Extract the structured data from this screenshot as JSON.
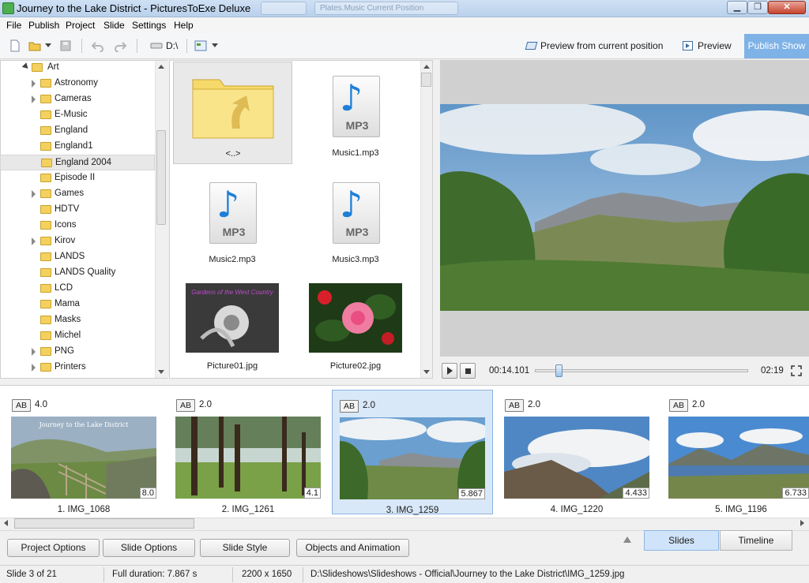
{
  "window": {
    "title": "Journey to the Lake District - PicturesToExe Deluxe",
    "ghost_tab": "Plates.Music Current Position"
  },
  "menu": [
    "File",
    "Publish",
    "Project",
    "Slide",
    "Settings",
    "Help"
  ],
  "toolbar": {
    "drive": "D:\\",
    "preview_current": "Preview from current position",
    "preview": "Preview",
    "publish": "Publish Show"
  },
  "tree": {
    "root": "Art",
    "items": [
      {
        "label": "Astronomy",
        "expand": true
      },
      {
        "label": "Cameras",
        "expand": true
      },
      {
        "label": "E-Music",
        "expand": false
      },
      {
        "label": "England",
        "expand": false
      },
      {
        "label": "England1",
        "expand": false
      },
      {
        "label": "England 2004",
        "expand": false,
        "selected": true
      },
      {
        "label": "Episode II",
        "expand": false
      },
      {
        "label": "Games",
        "expand": true
      },
      {
        "label": "HDTV",
        "expand": false
      },
      {
        "label": "Icons",
        "expand": false
      },
      {
        "label": "Kirov",
        "expand": true
      },
      {
        "label": "LANDS",
        "expand": false
      },
      {
        "label": "LANDS Quality",
        "expand": false
      },
      {
        "label": "LCD",
        "expand": false
      },
      {
        "label": "Mama",
        "expand": false
      },
      {
        "label": "Masks",
        "expand": false
      },
      {
        "label": "Michel",
        "expand": false
      },
      {
        "label": "PNG",
        "expand": true
      },
      {
        "label": "Printers",
        "expand": true
      }
    ]
  },
  "files": [
    {
      "name": "<..>",
      "kind": "up-folder"
    },
    {
      "name": "Music1.mp3",
      "kind": "mp3"
    },
    {
      "name": "Music2.mp3",
      "kind": "mp3"
    },
    {
      "name": "Music3.mp3",
      "kind": "mp3"
    },
    {
      "name": "Picture01.jpg",
      "kind": "image"
    },
    {
      "name": "Picture02.jpg",
      "kind": "image"
    }
  ],
  "mp3_badge": "MP3",
  "playback": {
    "current": "00:14.101",
    "total": "02:19",
    "position_fraction": 0.11
  },
  "slides": [
    {
      "ab": "AB",
      "transition": "4.0",
      "duration": "8.0",
      "name": "1. IMG_1068",
      "caption": "Journey to the Lake District"
    },
    {
      "ab": "AB",
      "transition": "2.0",
      "duration": "4.1",
      "name": "2. IMG_1261"
    },
    {
      "ab": "AB",
      "transition": "2.0",
      "duration": "5.867",
      "name": "3. IMG_1259",
      "selected": true
    },
    {
      "ab": "AB",
      "transition": "2.0",
      "duration": "4.433",
      "name": "4. IMG_1220"
    },
    {
      "ab": "AB",
      "transition": "2.0",
      "duration": "6.733",
      "name": "5. IMG_1196"
    }
  ],
  "bottom": {
    "project_options": "Project Options",
    "slide_options": "Slide Options",
    "slide_style": "Slide Style",
    "objects_animation": "Objects and Animation",
    "tab_slides": "Slides",
    "tab_timeline": "Timeline"
  },
  "status": {
    "slide": "Slide 3 of 21",
    "duration": "Full duration: 7.867 s",
    "size": "2200 x 1650",
    "path": "D:\\Slideshows\\Slideshows - Official\\Journey to the Lake District\\IMG_1259.jpg"
  },
  "colors": {
    "accent": "#7fb2e6",
    "selection": "#d9e8f8",
    "folder": "#f4d15f"
  }
}
